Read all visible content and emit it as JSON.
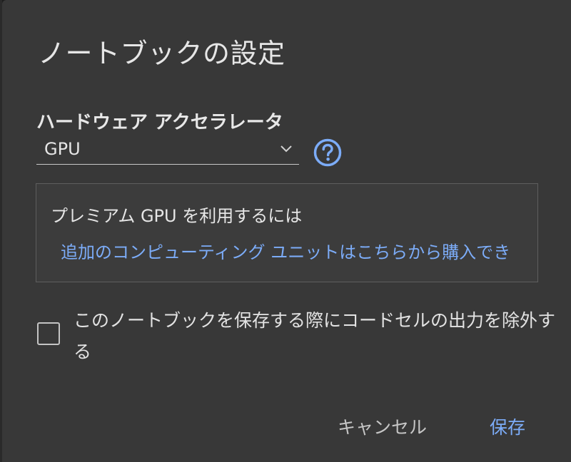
{
  "dialog": {
    "title": "ノートブックの設定",
    "accelerator": {
      "label": "ハードウェア アクセラレータ",
      "selected": "GPU",
      "help_icon": "help-circle-icon"
    },
    "premium": {
      "text": "プレミアム GPU を利用するには",
      "link": "追加のコンピューティング ユニットはこちらから購入でき"
    },
    "exclude_output": {
      "label": "このノートブックを保存する際にコードセルの出力を除外する",
      "checked": false
    },
    "buttons": {
      "cancel": "キャンセル",
      "save": "保存"
    }
  },
  "colors": {
    "dialog_bg": "#383838",
    "link": "#7cacf8",
    "text": "#e3e3e3"
  }
}
